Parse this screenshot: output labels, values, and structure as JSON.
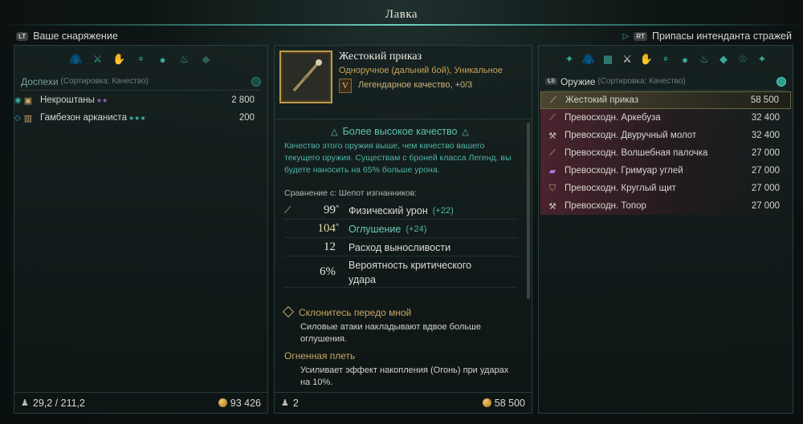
{
  "window": {
    "title": "Лавка"
  },
  "topbar": {
    "left_key": "LT",
    "left_label": "Ваше снаряжение",
    "right_key": "RT",
    "right_label": "Припасы интенданта стражей"
  },
  "left": {
    "tab_icons": [
      "chest-armor-icon",
      "swords-icon",
      "glove-icon",
      "rings-icon",
      "orbs-icon",
      "lamp-icon",
      "gem-icon"
    ],
    "category": "Доспехи",
    "sort": "(Сортировка: Качество)",
    "items": [
      {
        "icon": "pants-icon",
        "name": "Некроштаны",
        "stars": "★★",
        "price": "2 800"
      },
      {
        "icon": "gambeson-icon",
        "name": "Гамбезон арканиста",
        "stars": "★★★",
        "price": "200"
      }
    ],
    "weight": "29,2 / 211,2",
    "gold": "93 426"
  },
  "middle": {
    "name": "Жестокий приказ",
    "type": "Одноручное (дальний бой), Уникальное",
    "quality_badge": "V",
    "quality": "Легендарное качество, +0/3",
    "higher_quality_title": "Более высокое качество",
    "higher_quality_text": "Качество этого оружия выше, чем качество вашего текущего оружия. Существам с броней класса Легенд. вы будете наносить на 65% больше урона.",
    "compare_label": "Сравнение с: Шепот изгнанников:",
    "stats": [
      {
        "value": "99",
        "label": "Физический урон",
        "bonus": "(+22)"
      },
      {
        "value": "104",
        "label": "Оглушение",
        "bonus": "(+24)"
      },
      {
        "value": "12",
        "label": "Расход выносливости",
        "bonus": ""
      },
      {
        "value": "6%",
        "label": "Вероятность критического удара",
        "bonus": ""
      }
    ],
    "perks": [
      {
        "title": "Склонитесь передо мной",
        "text": "Силовые атаки накладывают вдвое больше оглушения."
      },
      {
        "title": "Огненная плеть",
        "text": "Усиливает эффект накопления (Огонь) при ударах на 10%."
      }
    ],
    "count": "2",
    "price": "58 500"
  },
  "right": {
    "tab_icons": [
      "gear-icon",
      "chest-armor-icon",
      "cube-icon",
      "swords-icon",
      "glove-icon",
      "rings-icon",
      "orbs-icon",
      "lamp-icon",
      "gem-icon",
      "crown-icon",
      "gear-icon"
    ],
    "key": "LS",
    "category": "Оружие",
    "sort": "(Сортировка: Качество)",
    "items": [
      {
        "name": "Жестокий приказ",
        "price": "58 500"
      },
      {
        "name": "Превосходн. Аркебуза",
        "price": "32 400"
      },
      {
        "name": "Превосходн. Двуручный молот",
        "price": "32 400"
      },
      {
        "name": "Превосходн. Волшебная палочка",
        "price": "27 000"
      },
      {
        "name": "Превосходн. Гримуар углей",
        "price": "27 000"
      },
      {
        "name": "Превосходн. Круглый щит",
        "price": "27 000"
      },
      {
        "name": "Превосходн. Топор",
        "price": "27 000"
      }
    ]
  }
}
